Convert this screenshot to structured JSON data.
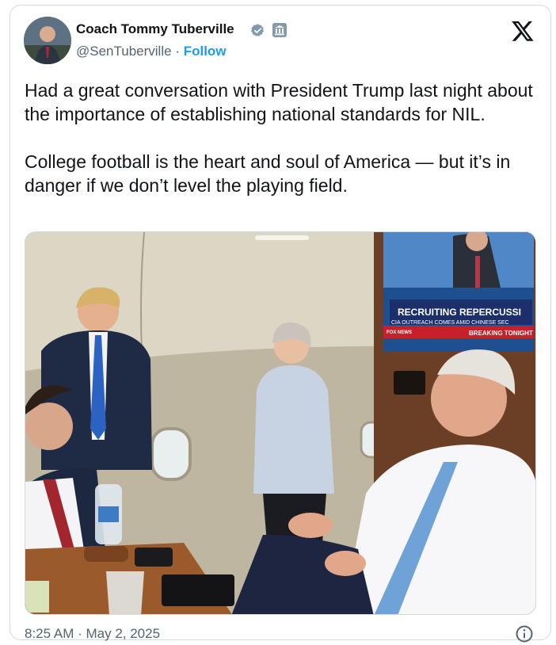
{
  "author": {
    "name": "Coach Tommy Tuberville",
    "handle": "@SenTuberville",
    "separator": "·",
    "follow_label": "Follow",
    "verified_icon": "verified-badge-icon",
    "affiliation_icon": "government-building-icon"
  },
  "tweet": {
    "paragraph_1": "Had a great conversation with President Trump last night about the importance of establishing national standards for NIL.",
    "paragraph_2": "College football is the heart and soul of America — but it’s in danger if we don’t level the playing field."
  },
  "photo": {
    "tv_network": "FOX NEWS",
    "tv_headline": "RECRUITING REPERCUSSI",
    "tv_subline": "CIA OUTREACH COMES AMID CHINESE SEC",
    "tv_tag": "BREAKING TONIGHT"
  },
  "timestamp": "8:25 AM · May 2, 2025",
  "colors": {
    "accent": "#1d9bf0",
    "text": "#0f1419",
    "muted": "#536471",
    "border": "#cfd9de"
  }
}
